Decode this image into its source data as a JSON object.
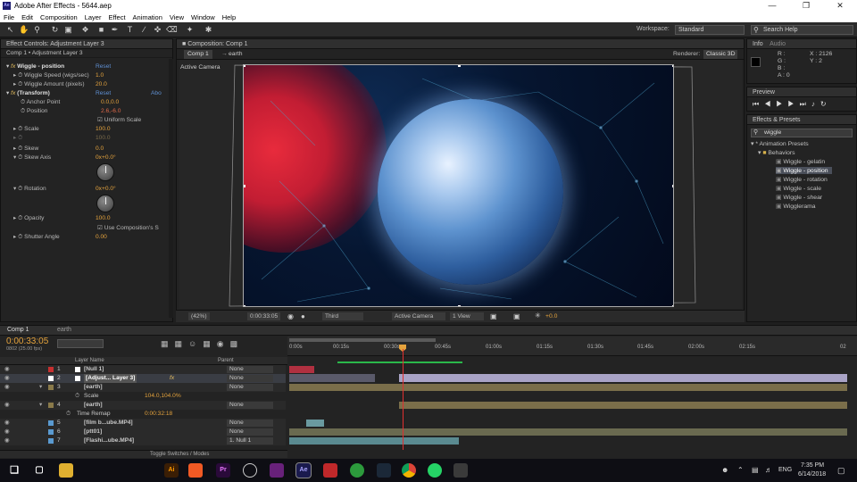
{
  "window": {
    "title": "Adobe After Effects - 5644.aep",
    "app_icon": "Ae"
  },
  "menu": [
    "File",
    "Edit",
    "Composition",
    "Layer",
    "Effect",
    "Animation",
    "View",
    "Window",
    "Help"
  ],
  "toolbar": {
    "workspace_label": "Workspace:",
    "workspace_value": "Standard",
    "search_placeholder": "Search Help"
  },
  "effect_controls": {
    "tab": "Effect Controls: Adjustment Layer 3",
    "breadcrumb": "Comp 1 • Adjustment Layer 3",
    "rows": [
      {
        "label": "Wiggle - position",
        "value": "Reset",
        "y": 0
      },
      {
        "label": "Wiggle Speed (wigs/sec)",
        "value": "1.0"
      },
      {
        "label": "Wiggle Amount (pixels)",
        "value": "20.0"
      },
      {
        "label": "(Transform)",
        "value": "Reset",
        "extra": "Abo"
      },
      {
        "label": "Anchor Point",
        "value": "0.0,0.0"
      },
      {
        "label": "Position",
        "value": "2.6,-6.0"
      },
      {
        "label": "Uniform Scale",
        "value": ""
      },
      {
        "label": "Scale",
        "value": "100.0"
      },
      {
        "label": "",
        "value": "100.0"
      },
      {
        "label": "Skew",
        "value": "0.0"
      },
      {
        "label": "Skew Axis",
        "value": "0x+0.0°"
      },
      {
        "label": "Rotation",
        "value": "0x+0.0°"
      },
      {
        "label": "Opacity",
        "value": "100.0"
      },
      {
        "label": "Use Composition's S",
        "value": ""
      },
      {
        "label": "Shutter Angle",
        "value": "0.00"
      }
    ]
  },
  "composition": {
    "tab": "Composition: Comp 1",
    "sub_tab": "Comp 1",
    "breadcrumb": "earth",
    "renderer_label": "Renderer:",
    "renderer_value": "Classic 3D",
    "camera_label": "Active Camera",
    "zoom": "(42%)",
    "timecode": "0:00:33:05",
    "resolution": "Third",
    "view_camera": "Active Camera",
    "views": "1 View",
    "exposure": "+0.0"
  },
  "info": {
    "tab": "Info",
    "tab2": "Audio",
    "r": "R :",
    "g": "G :",
    "b": "B :",
    "a": "A : 0",
    "x": "X : 2126",
    "y": "Y : 2"
  },
  "preview": {
    "tab": "Preview"
  },
  "effects_presets": {
    "tab": "Effects & Presets",
    "search": "wiggle",
    "root": "* Animation Presets",
    "folder": "Behaviors",
    "items": [
      "Wiggle - gelatin",
      "Wiggle - position",
      "Wiggle - rotation",
      "Wiggle - scale",
      "Wiggle - shear",
      "Wigglerama"
    ],
    "selected_index": 1
  },
  "timeline": {
    "tab": "Comp 1",
    "tab2": "earth",
    "timecode": "0:00:33:05",
    "frame_info": "0802 (25.00 fps)",
    "col_layer_name": "Layer Name",
    "col_parent": "Parent",
    "ruler": [
      "0:00s",
      "00:15s",
      "00:30s",
      "00:45s",
      "01:00s",
      "01:15s",
      "01:30s",
      "01:45s",
      "02:00s",
      "02:15s",
      "02"
    ],
    "layers": [
      {
        "num": "1",
        "name": "[Null 1]",
        "color": "#c83030",
        "parent": "None"
      },
      {
        "num": "2",
        "name": "[Adjust... Layer 3]",
        "color": "#ffffff",
        "parent": "None"
      },
      {
        "num": "3",
        "name": "[earth]",
        "color": "#8a7a4a",
        "parent": "None"
      },
      {
        "num": "",
        "name": "Scale",
        "value": "104.0,104.0%",
        "parent": ""
      },
      {
        "num": "4",
        "name": "[earth]",
        "color": "#8a7a4a",
        "parent": "None"
      },
      {
        "num": "",
        "name": "Time Remap",
        "value": "0:00:32:18",
        "parent": ""
      },
      {
        "num": "5",
        "name": "[film b...ube.MP4]",
        "color": "#5a9ad0",
        "parent": "None"
      },
      {
        "num": "6",
        "name": "[ptt01]",
        "color": "#5a9ad0",
        "parent": "None"
      },
      {
        "num": "7",
        "name": "[Flashi...ube.MP4]",
        "color": "#5a9ad0",
        "parent": "1. Null 1"
      }
    ],
    "footer": "Toggle Switches / Modes"
  },
  "taskbar": {
    "apps": [
      "windows-logo",
      "search",
      "task-view",
      "file-explorer",
      "illustrator",
      "premiere",
      "chrome-alt",
      "visual-studio",
      "after-effects",
      "photoshop-red",
      "green-app",
      "steam",
      "chrome",
      "whatsapp",
      "calculator"
    ],
    "lang": "ENG",
    "time": "7:35 PM",
    "date": "6/14/2018"
  }
}
